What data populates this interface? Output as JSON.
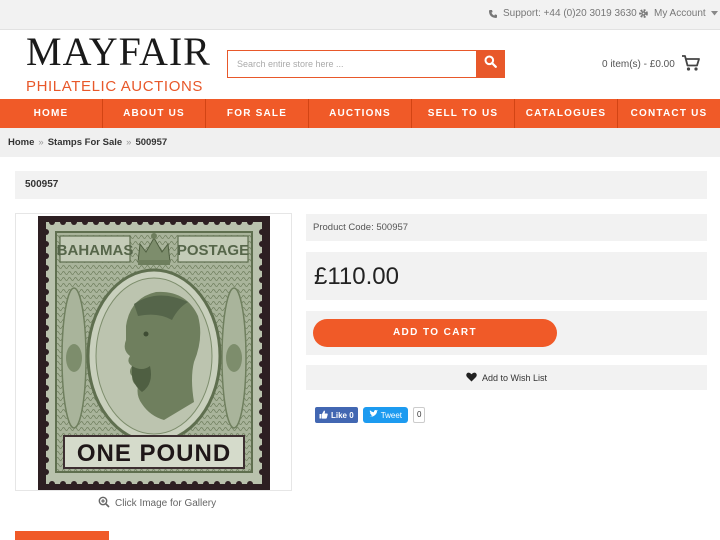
{
  "topbar": {
    "support_label": "Support: +44 (0)20 3019 3630",
    "account_label": "My Account"
  },
  "logo": {
    "line1": "MAYFAIR",
    "line2": "PHILATELIC AUCTIONS"
  },
  "search": {
    "placeholder": "Search entire store here ..."
  },
  "cart": {
    "summary": "0 item(s) - £0.00"
  },
  "nav": {
    "items": [
      "HOME",
      "ABOUT US",
      "FOR SALE",
      "AUCTIONS",
      "SELL TO US",
      "CATALOGUES",
      "CONTACT US"
    ]
  },
  "breadcrumb": {
    "items": [
      "Home",
      "Stamps For Sale",
      "500957"
    ],
    "separator": "»"
  },
  "product": {
    "title": "500957",
    "code_label": "Product Code: 500957",
    "price": "£110.00",
    "add_to_cart": "ADD TO CART",
    "wishlist": "Add to Wish List",
    "gallery_hint": "Click Image for Gallery",
    "stamp": {
      "top_left": "BAHAMAS",
      "top_right": "POSTAGE",
      "value": "ONE POUND"
    }
  },
  "social": {
    "like_label": "Like 0",
    "tweet_label": "Tweet",
    "tweet_count": "0"
  },
  "colors": {
    "accent": "#f05a28",
    "stamp_green": "#7d8d6c",
    "panel_grey": "#f2f2f2"
  }
}
